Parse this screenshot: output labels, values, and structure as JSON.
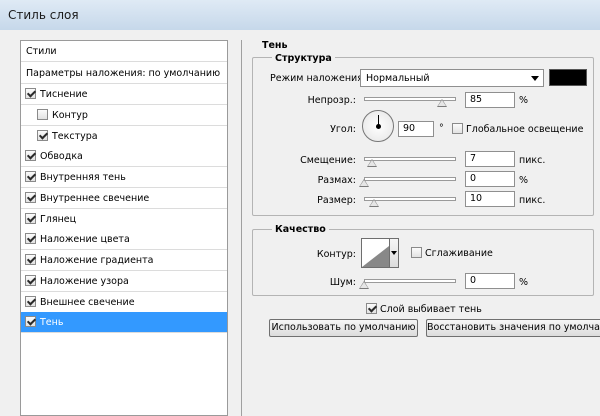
{
  "window": {
    "title": "Стиль слоя"
  },
  "left_panel": {
    "styles_header": "Стили",
    "blending_options": "Параметры наложения: по умолчанию",
    "items": [
      {
        "label": "Тиснение",
        "checked": true,
        "indent": false,
        "selected": false
      },
      {
        "label": "Контур",
        "checked": false,
        "indent": true,
        "selected": false
      },
      {
        "label": "Текстура",
        "checked": true,
        "indent": true,
        "selected": false
      },
      {
        "label": "Обводка",
        "checked": true,
        "indent": false,
        "selected": false
      },
      {
        "label": "Внутренняя тень",
        "checked": true,
        "indent": false,
        "selected": false
      },
      {
        "label": "Внутреннее свечение",
        "checked": true,
        "indent": false,
        "selected": false
      },
      {
        "label": "Глянец",
        "checked": true,
        "indent": false,
        "selected": false
      },
      {
        "label": "Наложение цвета",
        "checked": true,
        "indent": false,
        "selected": false
      },
      {
        "label": "Наложение градиента",
        "checked": true,
        "indent": false,
        "selected": false
      },
      {
        "label": "Наложение узора",
        "checked": true,
        "indent": false,
        "selected": false
      },
      {
        "label": "Внешнее свечение",
        "checked": true,
        "indent": false,
        "selected": false
      },
      {
        "label": "Тень",
        "checked": true,
        "indent": false,
        "selected": true
      }
    ]
  },
  "shadow": {
    "group_title": "Тень",
    "structure": {
      "title": "Структура",
      "blend_mode_label": "Режим наложения:",
      "blend_mode_value": "Нормальный",
      "shadow_color": "#000000",
      "opacity_label": "Непрозр.:",
      "opacity_value": "85",
      "opacity_fraction": 0.85,
      "opacity_unit": "%",
      "angle_label": "Угол:",
      "angle_value": "90",
      "angle_unit": "°",
      "global_light_label": "Глобальное освещение",
      "global_light_checked": false,
      "distance_label": "Смещение:",
      "distance_value": "7",
      "distance_unit": "пикс.",
      "spread_label": "Размах:",
      "spread_value": "0",
      "spread_unit": "%",
      "size_label": "Размер:",
      "size_value": "10",
      "size_unit": "пикс."
    },
    "quality": {
      "title": "Качество",
      "contour_label": "Контур:",
      "antialias_label": "Сглаживание",
      "antialias_checked": false,
      "noise_label": "Шум:",
      "noise_value": "0",
      "noise_unit": "%"
    },
    "knocks_out_label": "Слой выбивает тень",
    "knocks_out_checked": true,
    "make_default_button": "Использовать по умолчанию",
    "reset_default_button": "Восстановить значения по умолчанию"
  },
  "colors": {
    "selection": "#3399ff",
    "titlebar_top": "#dfeaf5",
    "titlebar_bottom": "#c6d8ea"
  },
  "icons": {
    "checkbox": "checkbox-icon",
    "dropdown": "chevron-down-icon",
    "angle_dial": "angle-dial-icon",
    "contour": "contour-curve-icon"
  }
}
